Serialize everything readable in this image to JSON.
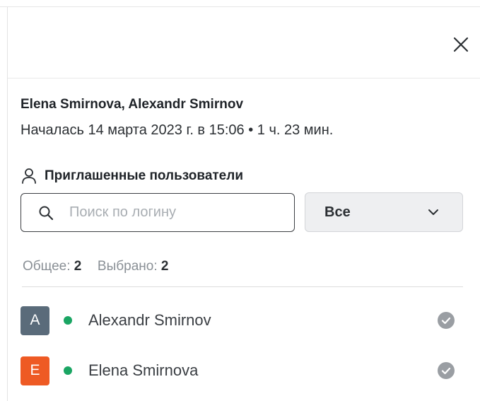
{
  "colors": {
    "status_online": "#1aa563",
    "avatar_a": "#5a6b7a",
    "avatar_e": "#ee5a24",
    "check": "#9a9ea3"
  },
  "header": {
    "close_icon": "close-icon"
  },
  "call": {
    "participants": "Elena Smirnova, Alexandr Smirnov",
    "meta": "Началась 14 марта 2023 г. в 15:06 • 1 ч. 23 мин."
  },
  "invited": {
    "section_icon": "user-icon",
    "title": "Приглашенные пользователи",
    "search_placeholder": "Поиск по логину",
    "search_value": "",
    "filter_value": "Все",
    "total_label": "Общее:",
    "total_value": "2",
    "selected_label": "Выбрано:",
    "selected_value": "2",
    "users": [
      {
        "initial": "A",
        "name": "Alexandr Smirnov",
        "status": "online"
      },
      {
        "initial": "E",
        "name": "Elena Smirnova",
        "status": "online"
      }
    ]
  }
}
